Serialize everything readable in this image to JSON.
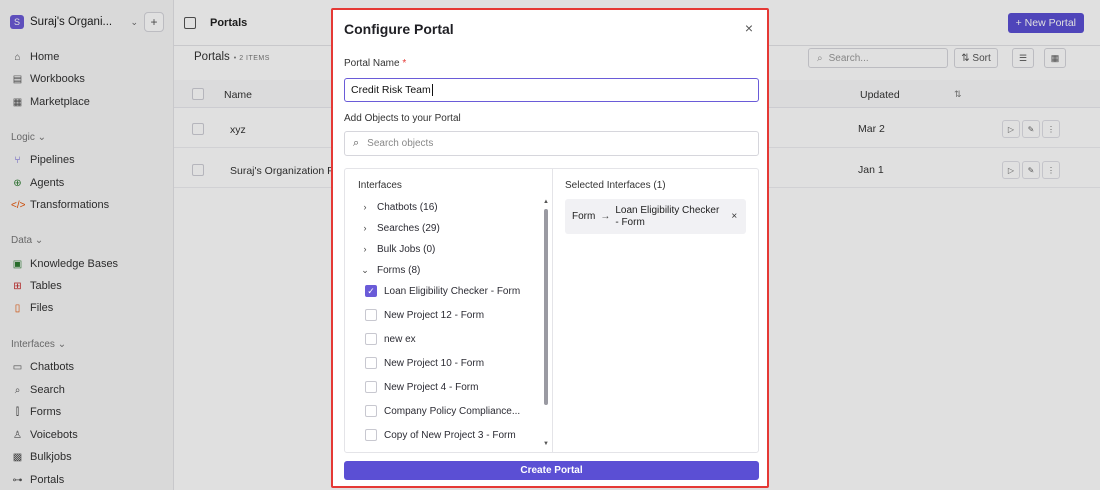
{
  "sidebar": {
    "org_name": "Suraj's Organi...",
    "org_logo": "S",
    "org_caret": "⌄",
    "plus": "+",
    "home": "Home",
    "workbooks": "Workbooks",
    "marketplace": "Marketplace",
    "logic_section": "Logic ⌄",
    "pipelines": "Pipelines",
    "agents": "Agents",
    "transformations": "Transformations",
    "data_section": "Data ⌄",
    "knowledge_bases": "Knowledge Bases",
    "tables": "Tables",
    "files": "Files",
    "interfaces_section": "Interfaces ⌄",
    "chatbots": "Chatbots",
    "search": "Search",
    "forms": "Forms",
    "voicebots": "Voicebots",
    "bulkjobs": "Bulkjobs",
    "portals": "Portals"
  },
  "header": {
    "title": "Portals",
    "new_portal": "+ New Portal"
  },
  "list": {
    "title": "Portals",
    "count": "• 2 ITEMS",
    "search_placeholder": "Search...",
    "sort": "⇅ Sort",
    "columns": {
      "name": "Name",
      "updated": "Updated",
      "sort_icon": "⇅"
    },
    "rows": [
      {
        "name": "xyz",
        "updated": "Mar 2"
      },
      {
        "name": "Suraj's Organization P",
        "updated": "Jan 1"
      }
    ]
  },
  "modal": {
    "title": "Configure Portal",
    "close": "×",
    "portal_name_label": "Portal Name",
    "required_mark": "*",
    "portal_name_value": "Credit Risk Team",
    "add_objects_label": "Add Objects to your Portal",
    "search_placeholder": "Search objects",
    "interfaces_title": "Interfaces",
    "tree": [
      {
        "label": "Chatbots (16)",
        "chevron": "›"
      },
      {
        "label": "Searches (29)",
        "chevron": "›"
      },
      {
        "label": "Bulk Jobs (0)",
        "chevron": "›"
      },
      {
        "label": "Forms (8)",
        "chevron": "⌄"
      }
    ],
    "form_items": [
      {
        "label": "Loan Eligibility Checker - Form",
        "checked": true
      },
      {
        "label": "New Project 12 - Form",
        "checked": false
      },
      {
        "label": "new ex",
        "checked": false
      },
      {
        "label": "New Project 10 - Form",
        "checked": false
      },
      {
        "label": "New Project 4 - Form",
        "checked": false
      },
      {
        "label": "Company Policy Compliance...",
        "checked": false
      },
      {
        "label": "Copy of New Project 3 - Form",
        "checked": false
      }
    ],
    "selected_title": "Selected Interfaces (1)",
    "selected": {
      "type": "Form",
      "arrow": "→",
      "name": "Loan Eligibility Checker - Form",
      "remove": "×"
    },
    "create_button": "Create Portal"
  },
  "colors": {
    "accent": "#5b4fd4",
    "highlight_border": "#e53935"
  }
}
